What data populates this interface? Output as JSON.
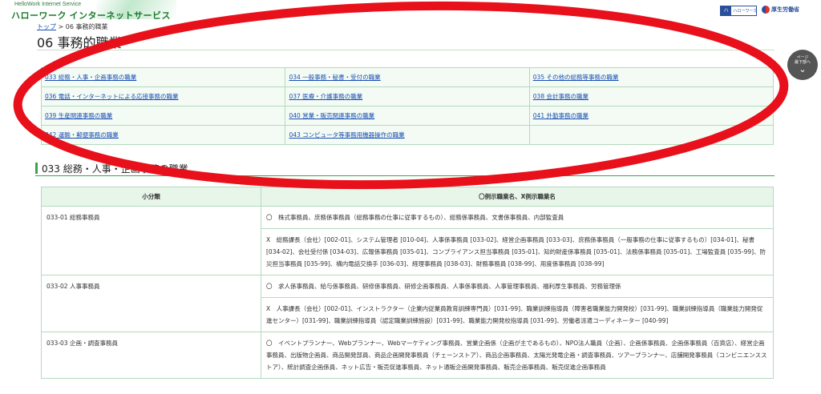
{
  "header": {
    "logo_sub": "HelloWork Internet Service",
    "logo_main": "ハローワーク インターネットサービス",
    "badge_block": "ハ",
    "badge_text": "ハローワーク",
    "ministry": "厚生労働省"
  },
  "breadcrumb": {
    "home": "トップ",
    "sep": " > ",
    "current": "06 事務的職業"
  },
  "page_title": "06 事務的職業",
  "page_down": {
    "label": "ページ\n最下部へ",
    "chevron": "⌄"
  },
  "categories": [
    [
      "033 総務・人事・企画事務の職業",
      "034 一般事務・秘書・受付の職業",
      "035 その他の総務等事務の職業"
    ],
    [
      "036 電話・インターネットによる応接事務の職業",
      "037 医療・介護事務の職業",
      "038 会計事務の職業"
    ],
    [
      "039 生産関連事務の職業",
      "040 営業・販売関連事務の職業",
      "041 外勤事務の職業"
    ],
    [
      "042 運輸・郵便事務の職業",
      "043 コンピュータ等事務用機器操作の職業",
      ""
    ]
  ],
  "section": {
    "title": "033 総務・人事・企画事務の職業"
  },
  "table": {
    "headers": [
      "小分類",
      "〇例示職業名、X例示職業名"
    ],
    "rows": [
      {
        "sub": "033-01 総務事務員",
        "lines": [
          "〇　株式事務員、庶務係事務員（総務事務の仕事に従事するもの）、総務係事務員、文書係事務員、内部監査員",
          "X　総務課長（会社）[002-01]、システム管理者 [010-04]、人事係事務員 [033-02]、経営企画事務員 [033-03]、庶務係事務員（一般事務の仕事に従事するもの）[034-01]、秘書 [034-02]、会社受付係 [034-03]、広報係事務員 [035-01]、コンプライアンス担当事務員 [035-01]、知的財産係事務員 [035-01]、法務係事務員 [035-01]、工場監査員 [035-99]、防災担当事務員 [035-99]、構内電話交換手 [036-03]、経理事務員 [038-03]、財務事務員 [038-99]、用度係事務員 [038-99]"
        ]
      },
      {
        "sub": "033-02 人事事務員",
        "lines": [
          "〇　求人係事務員、給与係事務員、研修係事務員、研修企画事務員、人事係事務員、人事管理事務員、福利厚生事務員、労務管理係",
          "X　人事課長（会社）[002-01]、インストラクター（企業内従業員教育訓練専門員）[031-99]、職業訓練指導員（障害者職業能力開発校）[031-99]、職業訓練指導員（職業能力開発促進センター）[031-99]、職業訓練指導員（認定職業訓練施設）[031-99]、職業能力開発校指導員 [031-99]、労働者派遣コーディネーター [040-99]"
        ]
      },
      {
        "sub": "033-03 企画・調査事務員",
        "lines": [
          "〇　イベントプランナー、Webプランナー、Webマーケティング事務員、営業企画係（企画が主であるもの）、NPO法人職員（企画）、企画係事務員、企画係事務員（百貨店）、経営企画事務員、出版物企画員、商品開発部員、商品企画開発事務員（チェーンストア）、商品企画事務員、太陽光発電企画・調査事務員、ツアープランナー、店舗開発事務員（コンビニエンスストア）、統計調査企画係員、ネット広告・販売促進事務員、ネット通販企画開発事務員、販売企画事務員、販売促進企画事務員"
        ]
      }
    ]
  },
  "colors": {
    "accent_green": "#3aa34c",
    "link_blue": "#1a4fb3",
    "annotation_red": "#e8101a"
  }
}
